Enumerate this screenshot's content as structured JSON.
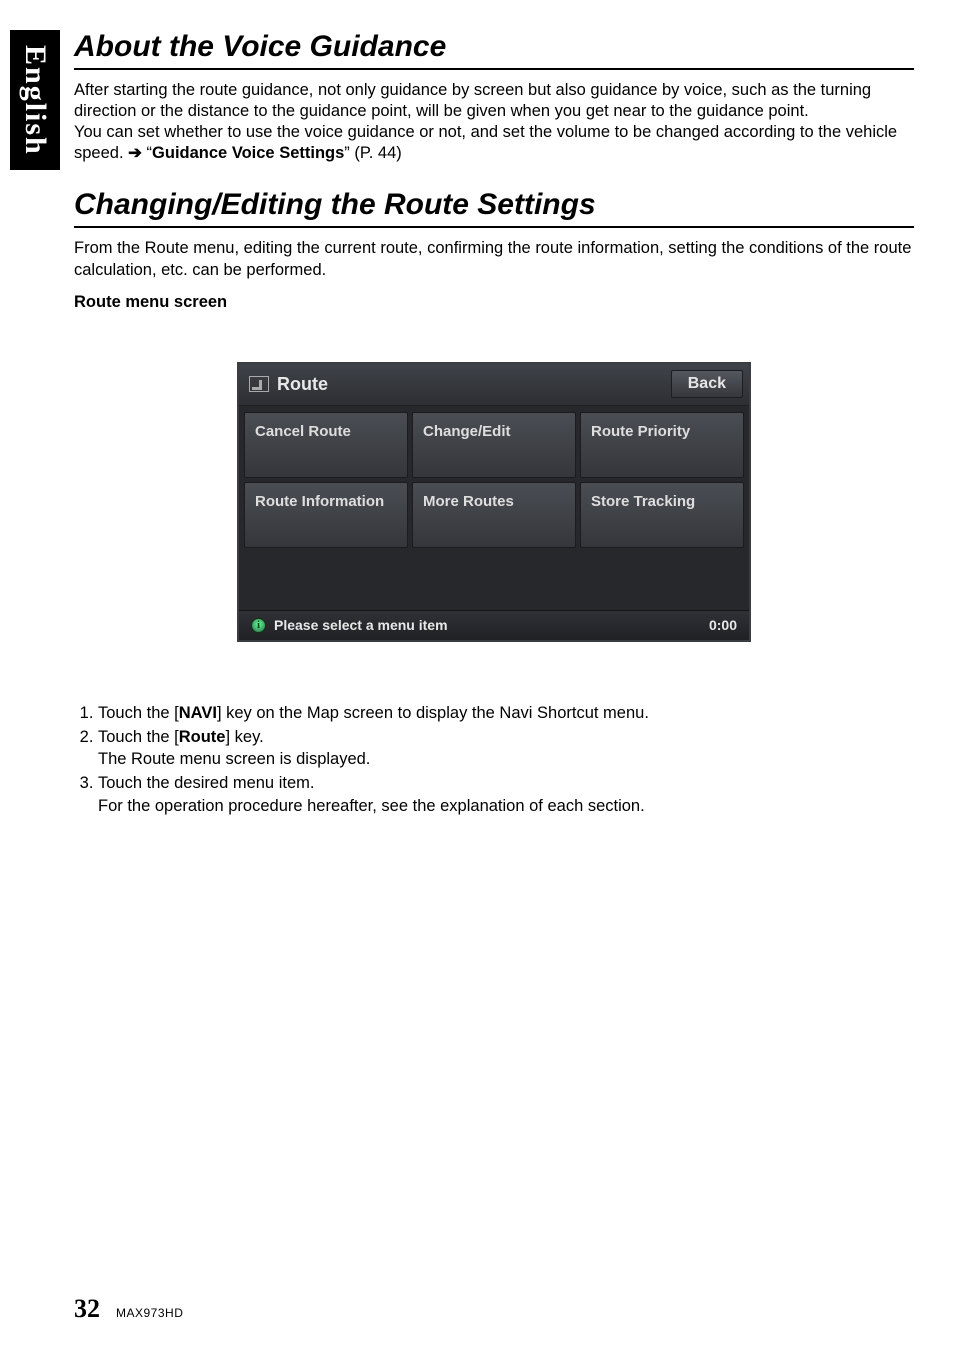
{
  "lang_tab": "English",
  "section1": {
    "title": "About the Voice Guidance",
    "para1": "After starting the route guidance, not only guidance by screen but also guidance by voice, such as the turning direction or the distance to the guidance point, will be given when you get near to the guidance point.",
    "para2_pre": "You can set whether to use the voice guidance or not, and set the volume to be changed according to the vehicle speed. ",
    "arrow": "➔",
    "para2_quote_open": " “",
    "para2_bold": "Guidance Voice Settings",
    "para2_quote_close": "” (P. 44)"
  },
  "section2": {
    "title": "Changing/Editing the Route Settings",
    "para": "From the Route menu, editing the current route, confirming the route information, setting the conditions of the route calculation, etc. can be performed.",
    "subhead": "Route menu screen"
  },
  "device": {
    "title": "Route",
    "back": "Back",
    "tiles": [
      "Cancel Route",
      "Change/Edit",
      "Route Priority",
      "Route Information",
      "More Routes",
      "Store Tracking"
    ],
    "footer_msg": "Please select a menu item",
    "footer_time": "0:00"
  },
  "steps": {
    "s1_pre": "Touch the [",
    "s1_bold": "NAVI",
    "s1_post": "] key on the Map screen to display the Navi Shortcut menu.",
    "s2_pre": "Touch the [",
    "s2_bold": "Route",
    "s2_post": "] key.",
    "s2_sub": "The Route menu screen is displayed.",
    "s3_line1": "Touch the desired menu item.",
    "s3_line2": "For the operation procedure hereafter, see the explanation of each section."
  },
  "footer": {
    "page": "32",
    "model": "MAX973HD"
  }
}
